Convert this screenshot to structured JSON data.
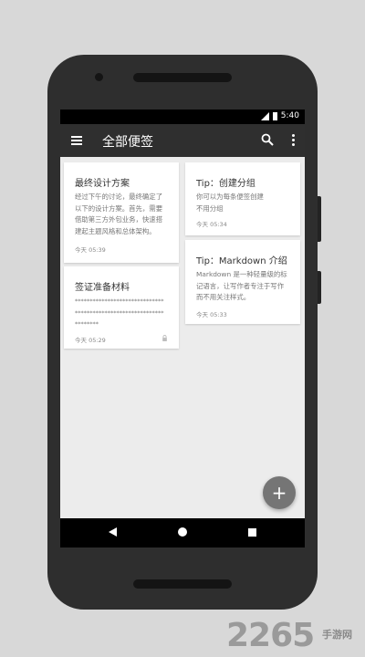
{
  "status_bar": {
    "time": "5:40"
  },
  "app_bar": {
    "title": "全部便签"
  },
  "notes_left": [
    {
      "title": "最终设计方案",
      "body_lines": [
        "经过下午的讨论，最终确定了",
        "以下的设计方案。首先，需要",
        "借助第三方外包业务，快速搭",
        "建起主题风格和总体架构。"
      ],
      "time": "今天 05:39"
    },
    {
      "title": "签证准备材料",
      "body_lines": [
        "******************************",
        "******************************",
        "********"
      ],
      "time": "今天 05:29",
      "locked": true
    }
  ],
  "notes_right": [
    {
      "title": "Tip：创建分组",
      "body_lines": [
        "你可以为每条便签创建",
        "不用分组"
      ],
      "time": "今天 05:34"
    },
    {
      "title": "Tip：Markdown 介绍",
      "body_lines": [
        "Markdown 是一种轻量级的标",
        "记语言，让写作者专注于写作",
        "而不用关注样式。"
      ],
      "time": "今天 05:33"
    }
  ],
  "fab": {
    "label": "+"
  },
  "watermark": {
    "brand": "2265",
    "sub": "手游网"
  },
  "colors": {
    "app_bar": "#2f2f2f",
    "background": "#ececec",
    "fab": "#757575"
  },
  "icons": [
    "menu-icon",
    "search-icon",
    "more-vert-icon",
    "lock-icon",
    "back-icon",
    "home-icon",
    "recents-icon"
  ]
}
